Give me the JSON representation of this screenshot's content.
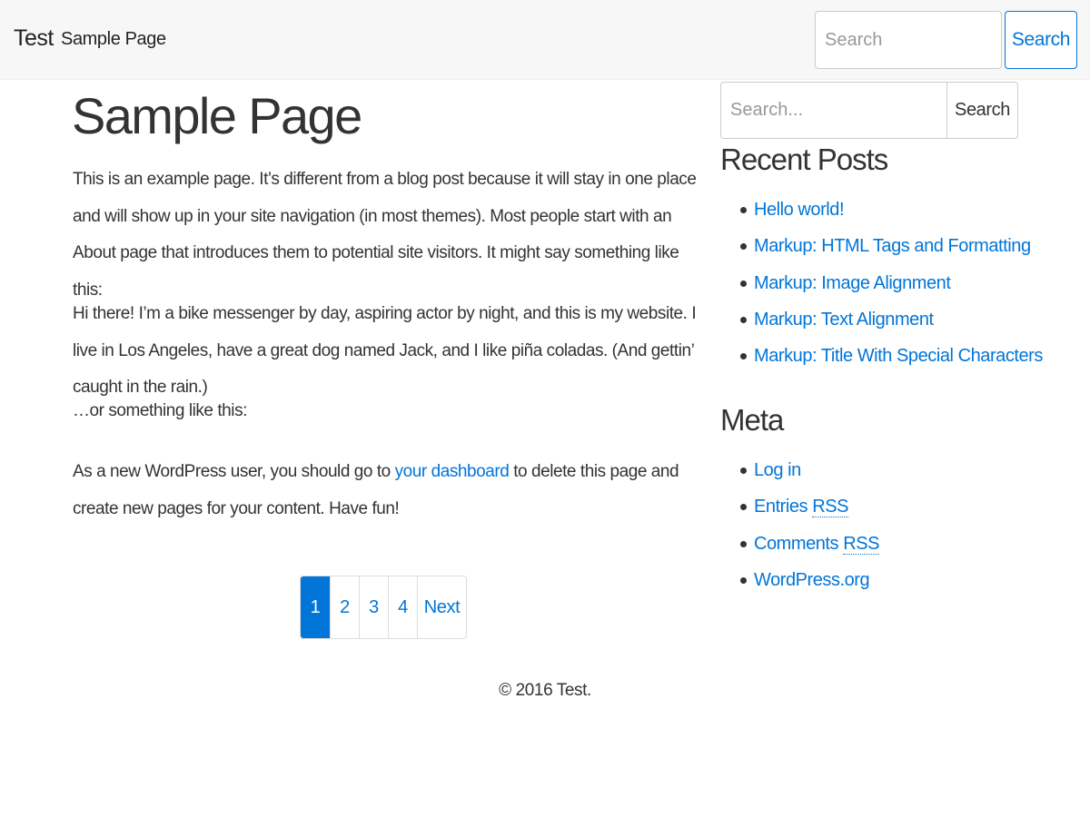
{
  "navbar": {
    "brand": "Test",
    "nav_link": "Sample Page",
    "search_placeholder": "Search",
    "search_button": "Search"
  },
  "main": {
    "title": "Sample Page",
    "paragraph1": "This is an example page. It’s different from a blog post because it will stay in one place and will show up in your site navigation (in most themes). Most people start with an About page that introduces them to potential site visitors. It might say something like this:",
    "paragraph2": "Hi there! I’m a bike messenger by day, aspiring actor by night, and this is my website. I live in Los Angeles, have a great dog named Jack, and I like piña coladas. (And gettin’ caught in the rain.)",
    "paragraph3": "…or something like this:",
    "paragraph4_before": "As a new WordPress user, you should go to ",
    "paragraph4_link": "your dashboard",
    "paragraph4_after": " to delete this page and create new pages for your content. Have fun!"
  },
  "pagination": {
    "pages": [
      "1",
      "2",
      "3",
      "4"
    ],
    "active_page": "1",
    "next_label": "Next"
  },
  "footer": {
    "text": "© 2016 Test."
  },
  "sidebar": {
    "search_placeholder": "Search...",
    "search_button": "Search",
    "recent_posts_title": "Recent Posts",
    "recent_posts": [
      "Hello world!",
      "Markup: HTML Tags and Formatting",
      "Markup: Image Alignment",
      "Markup: Text Alignment",
      "Markup: Title With Special Characters"
    ],
    "meta_title": "Meta",
    "meta_links": {
      "log_in": "Log in",
      "entries_prefix": "Entries ",
      "entries_abbr": "RSS",
      "comments_prefix": "Comments ",
      "comments_abbr": "RSS",
      "wordpress": "WordPress.org"
    }
  },
  "colors": {
    "link": "#0275d8",
    "navbar_bg": "#f7f7f7",
    "text": "#333333"
  }
}
